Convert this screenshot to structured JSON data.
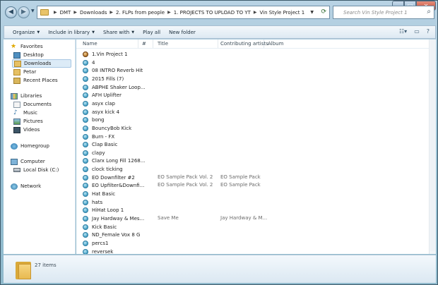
{
  "address": {
    "crumbs": [
      "DMT",
      "Downloads",
      "2. FLPs from people",
      "1. PROJECTS TO UPLOAD TO YT",
      "Vin Style Project 1"
    ]
  },
  "search": {
    "placeholder": "Search Vin Style Project 1"
  },
  "toolbar": {
    "organize": "Organize",
    "include": "Include in library",
    "share": "Share with",
    "play": "Play all",
    "newfolder": "New folder"
  },
  "nav": {
    "favorites": "Favorites",
    "desktop": "Desktop",
    "downloads": "Downloads",
    "petar": "Petar",
    "recent": "Recent Places",
    "libraries": "Libraries",
    "documents": "Documents",
    "music": "Music",
    "pictures": "Pictures",
    "videos": "Videos",
    "homegroup": "Homegroup",
    "computer": "Computer",
    "localdisk": "Local Disk (C:)",
    "network": "Network"
  },
  "columns": {
    "name": "Name",
    "num": "#",
    "title": "Title",
    "artists": "Contributing artists",
    "album": "Album"
  },
  "files": [
    {
      "name": "1.Vin Project 1",
      "title": "",
      "artist": "",
      "type": "project"
    },
    {
      "name": "4",
      "title": "",
      "artist": "",
      "type": "audio"
    },
    {
      "name": "08 INTRO Reverb Hit",
      "title": "",
      "artist": "",
      "type": "audio"
    },
    {
      "name": "2015 Fills  (7)",
      "title": "",
      "artist": "",
      "type": "audio"
    },
    {
      "name": "ABPHE Shaker Loop...",
      "title": "",
      "artist": "",
      "type": "audio"
    },
    {
      "name": "AFH Uplifter",
      "title": "",
      "artist": "",
      "type": "audio"
    },
    {
      "name": "asyx clap",
      "title": "",
      "artist": "",
      "type": "audio"
    },
    {
      "name": "asyx kick 4",
      "title": "",
      "artist": "",
      "type": "audio"
    },
    {
      "name": "bong",
      "title": "",
      "artist": "",
      "type": "audio"
    },
    {
      "name": "BouncyBob Kick",
      "title": "",
      "artist": "",
      "type": "audio"
    },
    {
      "name": "Burn - FX",
      "title": "",
      "artist": "",
      "type": "audio"
    },
    {
      "name": "Clap Basic",
      "title": "",
      "artist": "",
      "type": "audio"
    },
    {
      "name": "clapy",
      "title": "",
      "artist": "",
      "type": "audio"
    },
    {
      "name": "Clarx Long Fill 1268...",
      "title": "",
      "artist": "",
      "type": "audio"
    },
    {
      "name": "clock ticking",
      "title": "",
      "artist": "",
      "type": "audio"
    },
    {
      "name": "EO Downfilter #2",
      "title": "EO Sample Pack Vol. 2",
      "artist": "EO Sample Pack",
      "type": "audio"
    },
    {
      "name": "EO Upfilter&Downfi...",
      "title": "EO Sample Pack Vol. 2",
      "artist": "EO Sample Pack",
      "type": "audio"
    },
    {
      "name": "Hat Basic",
      "title": "",
      "artist": "",
      "type": "audio"
    },
    {
      "name": "hats",
      "title": "",
      "artist": "",
      "type": "audio"
    },
    {
      "name": "HiHat Loop 1",
      "title": "",
      "artist": "",
      "type": "audio"
    },
    {
      "name": "Jay Hardway & Mes...",
      "title": "Save Me",
      "artist": "Jay Hardway & M...",
      "type": "audio"
    },
    {
      "name": "Kick Basic",
      "title": "",
      "artist": "",
      "type": "audio"
    },
    {
      "name": "ND_Female Vox 8 G",
      "title": "",
      "artist": "",
      "type": "audio"
    },
    {
      "name": "percs1",
      "title": "",
      "artist": "",
      "type": "audio"
    },
    {
      "name": "reversek",
      "title": "",
      "artist": "",
      "type": "audio"
    }
  ],
  "details": {
    "count": "27 items"
  }
}
